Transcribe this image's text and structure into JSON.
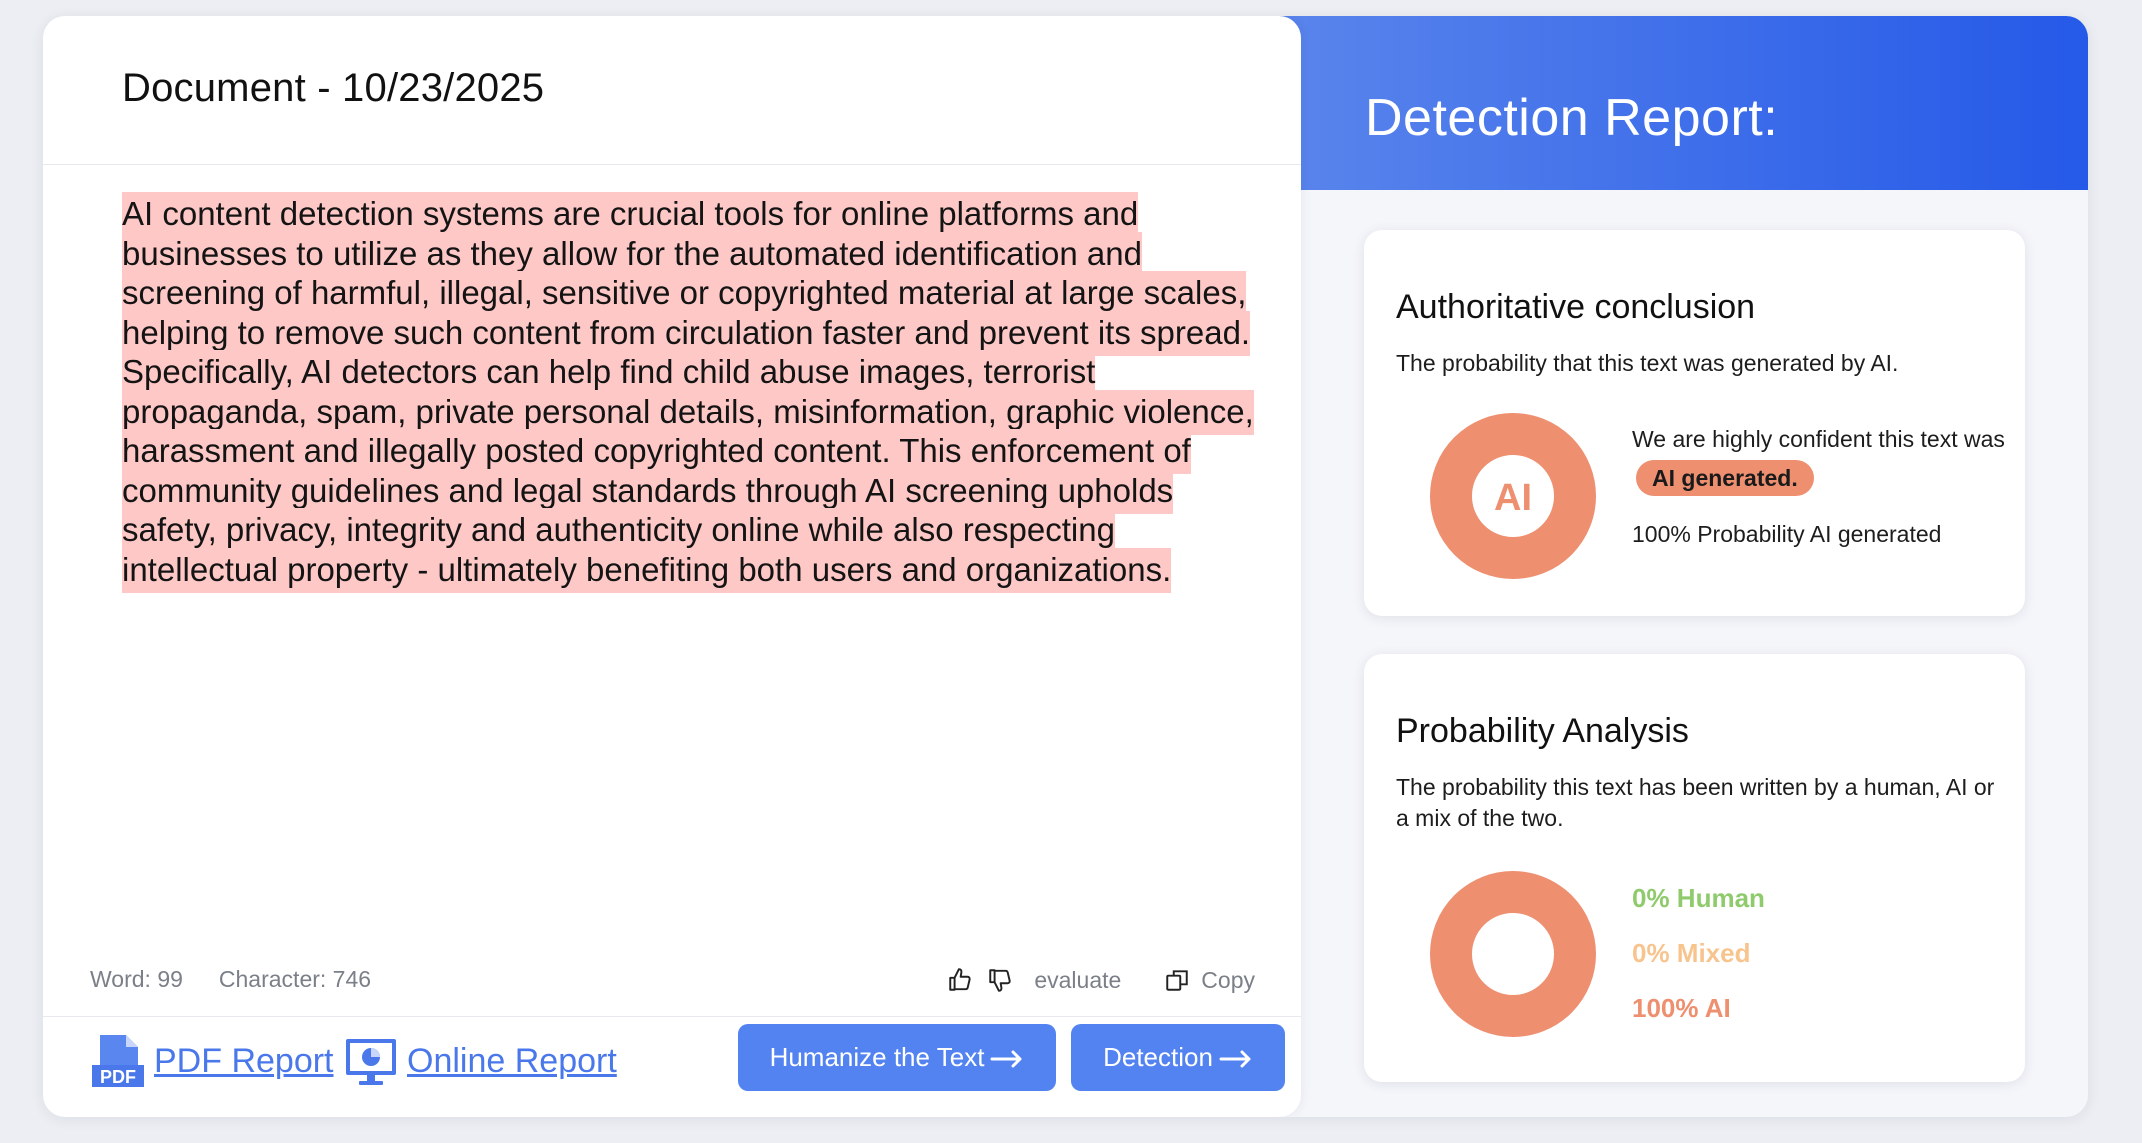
{
  "document": {
    "title": "Document - 10/23/2025",
    "text": "AI content detection systems are crucial tools for online platforms and businesses to utilize as they allow for the automated identification and screening of harmful, illegal, sensitive or copyrighted material at large scales, helping to remove such content from circulation faster and prevent its spread. Specifically, AI detectors can help find child abuse images, terrorist propaganda, spam, private personal details, misinformation, graphic violence, harassment and illegally posted copyrighted content. This enforcement of community guidelines and legal standards through AI screening upholds safety, privacy, integrity and authenticity online while also respecting intellectual property - ultimately benefiting both users and organizations.",
    "highlight_color": "#fdc8c6",
    "word_count_label": "Word: 99",
    "char_count_label": "Character: 746",
    "evaluate_label": "evaluate",
    "copy_label": "Copy"
  },
  "footer": {
    "pdf_report_label": "PDF Report",
    "online_report_label": "Online Report",
    "humanize_button_label": "Humanize the Text",
    "detection_button_label": "Detection",
    "accent_color": "#5283f1"
  },
  "report": {
    "title": "Detection Report:",
    "conclusion_card": {
      "heading": "Authoritative conclusion",
      "subtitle": "The probability that this text was generated by AI.",
      "donut_label": "AI",
      "confidence_prefix": "We are highly confident this text was",
      "verdict": "AI generated.",
      "probability_text": "100% Probability AI generated",
      "ai_probability": 1.0,
      "donut_color": "#ee8f70"
    },
    "analysis_card": {
      "heading": "Probability Analysis",
      "subtitle": "The probability this text has been written by a human, AI or a mix of the two.",
      "human_label": "0% Human",
      "mixed_label": "0% Mixed",
      "ai_label": "100% AI",
      "human_pct": 0,
      "mixed_pct": 0,
      "ai_pct": 100,
      "human_color": "#8fcb6c",
      "mixed_color": "#f8c48e",
      "ai_color": "#ee8f70"
    }
  }
}
